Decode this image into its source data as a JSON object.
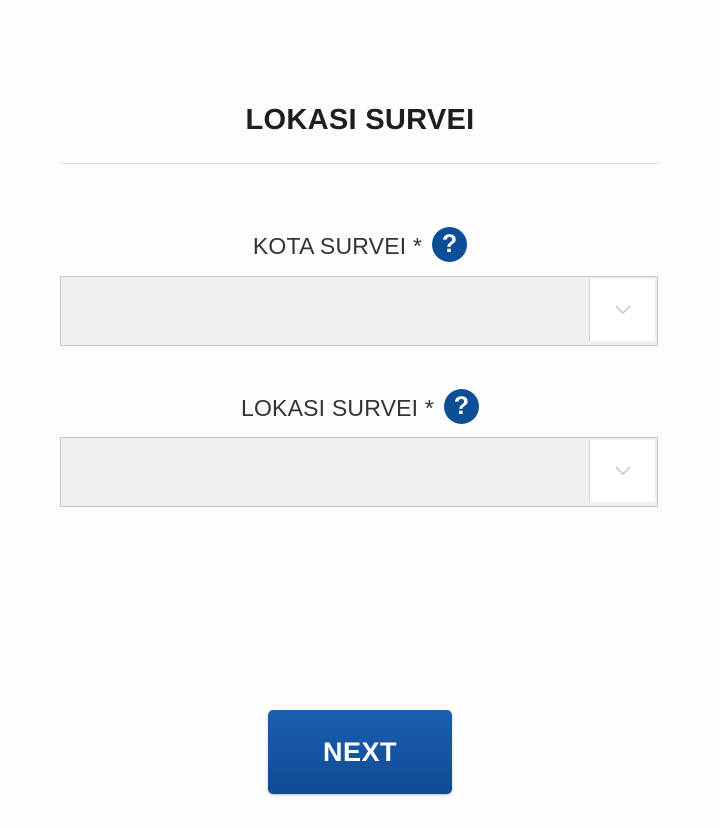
{
  "page": {
    "title": "LOKASI SURVEI"
  },
  "form": {
    "fields": [
      {
        "label": "KOTA SURVEI *",
        "help_icon": "question-circle-icon",
        "selected_value": ""
      },
      {
        "label": "LOKASI SURVEI *",
        "help_icon": "question-circle-icon",
        "selected_value": ""
      }
    ],
    "help_glyph": "?",
    "next_label": "NEXT"
  },
  "colors": {
    "accent": "#0d4f96",
    "button": "#1557a6",
    "select_background": "#efefef",
    "divider": "#dedede"
  }
}
